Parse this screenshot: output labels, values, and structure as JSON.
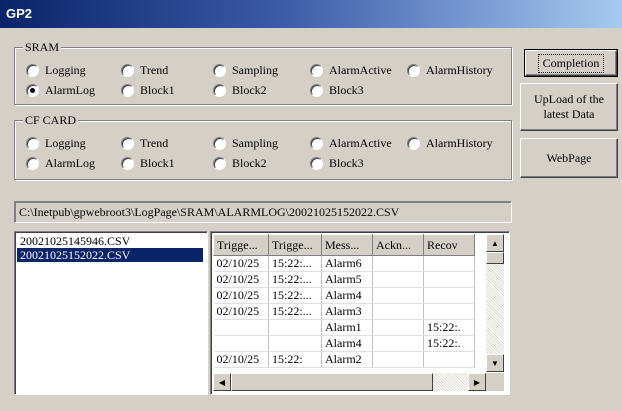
{
  "window": {
    "title": "GP2"
  },
  "sram": {
    "label": "SRAM",
    "options": [
      {
        "label": "Logging",
        "checked": false
      },
      {
        "label": "Trend",
        "checked": false
      },
      {
        "label": "Sampling",
        "checked": false
      },
      {
        "label": "AlarmActive",
        "checked": false
      },
      {
        "label": "AlarmHistory",
        "checked": false
      },
      {
        "label": "AlarmLog",
        "checked": true
      },
      {
        "label": "Block1",
        "checked": false
      },
      {
        "label": "Block2",
        "checked": false
      },
      {
        "label": "Block3",
        "checked": false
      }
    ]
  },
  "cfcard": {
    "label": "CF CARD",
    "options": [
      {
        "label": "Logging",
        "checked": false
      },
      {
        "label": "Trend",
        "checked": false
      },
      {
        "label": "Sampling",
        "checked": false
      },
      {
        "label": "AlarmActive",
        "checked": false
      },
      {
        "label": "AlarmHistory",
        "checked": false
      },
      {
        "label": "AlarmLog",
        "checked": false
      },
      {
        "label": "Block1",
        "checked": false
      },
      {
        "label": "Block2",
        "checked": false
      },
      {
        "label": "Block3",
        "checked": false
      }
    ]
  },
  "buttons": {
    "completion": "Completion",
    "upload_line1": "UpLoad of the",
    "upload_line2": "latest Data",
    "webpage": "WebPage"
  },
  "path": "C:\\Inetpub\\gpwebroot3\\LogPage\\SRAM\\ALARMLOG\\20021025152022.CSV",
  "files": [
    {
      "name": "20021025145946.CSV",
      "selected": false
    },
    {
      "name": "20021025152022.CSV",
      "selected": true
    }
  ],
  "table": {
    "headers": [
      "Trigge...",
      "Trigge...",
      "Mess...",
      "Ackn...",
      "Recov"
    ],
    "rows": [
      [
        "02/10/25",
        "15:22:...",
        "Alarm6",
        "",
        ""
      ],
      [
        "02/10/25",
        "15:22:...",
        "Alarm5",
        "",
        ""
      ],
      [
        "02/10/25",
        "15:22:...",
        "Alarm4",
        "",
        ""
      ],
      [
        "02/10/25",
        "15:22:...",
        "Alarm3",
        "",
        ""
      ],
      [
        "",
        "",
        "Alarm1",
        "",
        "15:22:."
      ],
      [
        "",
        "",
        "Alarm4",
        "",
        "15:22:."
      ],
      [
        "02/10/25",
        "15:22:",
        "Alarm2",
        "",
        ""
      ]
    ]
  },
  "icons": {
    "up": "scroll-up-arrow",
    "down": "scroll-down-arrow",
    "left": "scroll-left-arrow",
    "right": "scroll-right-arrow"
  }
}
